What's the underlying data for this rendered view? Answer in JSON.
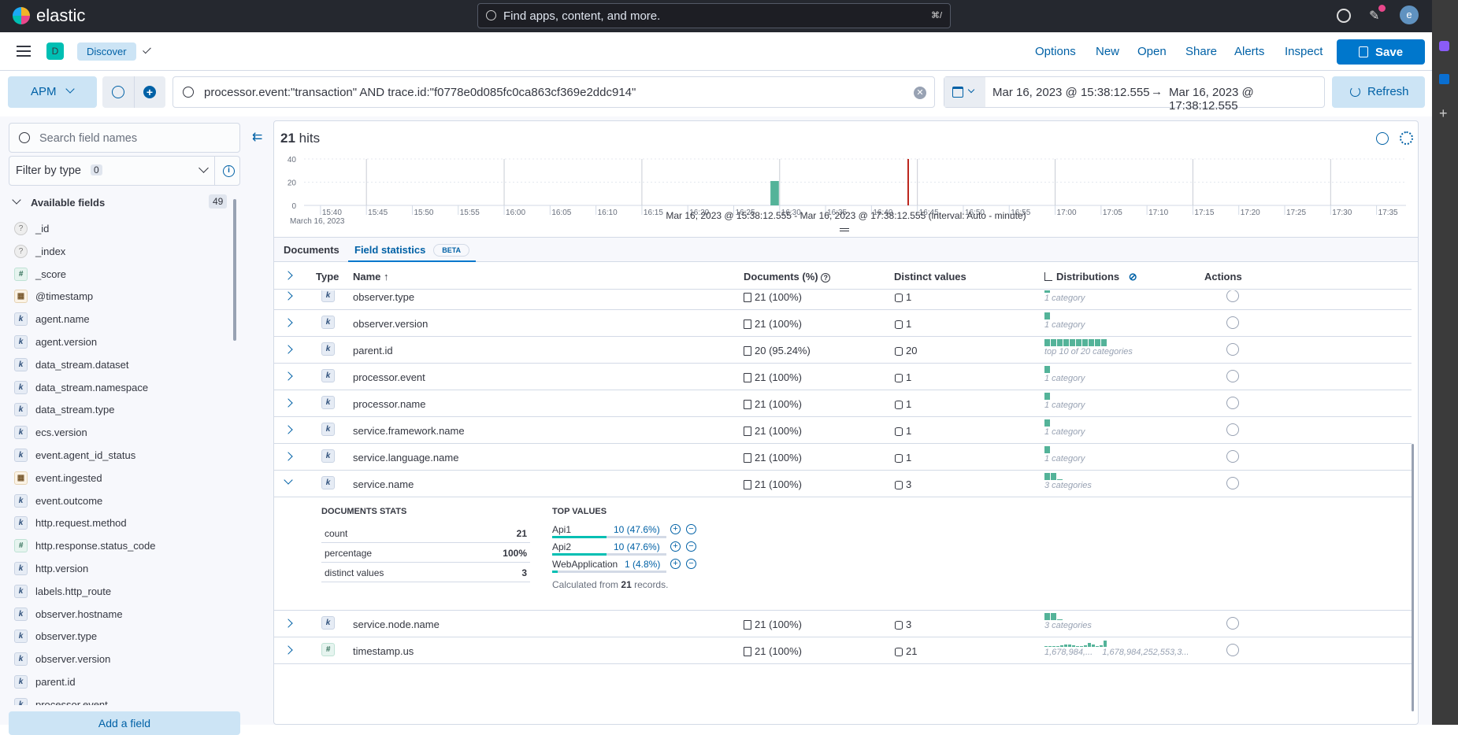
{
  "topbar": {
    "brand": "elastic",
    "search_placeholder": "Find apps, content, and more.",
    "shortcut": "⌘/",
    "avatar": "e"
  },
  "appbar": {
    "space": "D",
    "breadcrumb": "Discover",
    "links": [
      "Options",
      "New",
      "Open",
      "Share",
      "Alerts",
      "Inspect"
    ],
    "save": "Save"
  },
  "query": {
    "dataview": "APM",
    "value": "processor.event:\"transaction\" AND trace.id:\"f0778e0d085fc0ca863cf369e2ddc914\"",
    "date_start": "Mar 16, 2023 @ 15:38:12.555",
    "date_end": "Mar 16, 2023 @ 17:38:12.555",
    "arrow": "→",
    "refresh": "Refresh"
  },
  "sidebar": {
    "search_placeholder": "Search field names",
    "filter_label": "Filter by type",
    "filter_count": "0",
    "available_label": "Available fields",
    "available_count": "49",
    "fields": [
      {
        "name": "_id",
        "type": "unknown"
      },
      {
        "name": "_index",
        "type": "unknown"
      },
      {
        "name": "_score",
        "type": "number"
      },
      {
        "name": "@timestamp",
        "type": "date"
      },
      {
        "name": "agent.name",
        "type": "keyword"
      },
      {
        "name": "agent.version",
        "type": "keyword"
      },
      {
        "name": "data_stream.dataset",
        "type": "keyword"
      },
      {
        "name": "data_stream.namespace",
        "type": "keyword"
      },
      {
        "name": "data_stream.type",
        "type": "keyword"
      },
      {
        "name": "ecs.version",
        "type": "keyword"
      },
      {
        "name": "event.agent_id_status",
        "type": "keyword"
      },
      {
        "name": "event.ingested",
        "type": "date"
      },
      {
        "name": "event.outcome",
        "type": "keyword"
      },
      {
        "name": "http.request.method",
        "type": "keyword"
      },
      {
        "name": "http.response.status_code",
        "type": "number"
      },
      {
        "name": "http.version",
        "type": "keyword"
      },
      {
        "name": "labels.http_route",
        "type": "keyword"
      },
      {
        "name": "observer.hostname",
        "type": "keyword"
      },
      {
        "name": "observer.type",
        "type": "keyword"
      },
      {
        "name": "observer.version",
        "type": "keyword"
      },
      {
        "name": "parent.id",
        "type": "keyword"
      },
      {
        "name": "processor.event",
        "type": "keyword"
      }
    ],
    "add_field": "Add a field"
  },
  "hits": {
    "count": "21",
    "label": "hits"
  },
  "chart_data": {
    "type": "bar",
    "interval": "minute",
    "x_range": [
      "15:38:12.555",
      "17:38:12.555"
    ],
    "x_ticks": [
      "15:40",
      "15:45",
      "15:50",
      "15:55",
      "16:00",
      "16:05",
      "16:10",
      "16:15",
      "16:20",
      "16:25",
      "16:30",
      "16:35",
      "16:40",
      "16:45",
      "16:50",
      "16:55",
      "17:00",
      "17:05",
      "17:10",
      "17:15",
      "17:20",
      "17:25",
      "17:30",
      "17:35"
    ],
    "x_sublabel": "March 16, 2023",
    "y_ticks": [
      0,
      20,
      40
    ],
    "ylim": [
      0,
      40
    ],
    "bars": [
      {
        "x": "16:29",
        "value": 21
      }
    ],
    "current_time_marker": "16:44",
    "bar_color": "#54b399",
    "marker_color": "#bd271e",
    "caption": "Mar 16, 2023 @ 15:38:12.555 - Mar 16, 2023 @ 17:38:12.555 (interval: Auto - minute)"
  },
  "tabs": {
    "documents": "Documents",
    "field_stats": "Field statistics",
    "beta": "BETA"
  },
  "table": {
    "headers": {
      "type": "Type",
      "name": "Name ↑",
      "docs": "Documents (%)",
      "distinct": "Distinct values",
      "distributions": "Distributions",
      "actions": "Actions"
    },
    "rows": [
      {
        "name": "observer.type",
        "type": "keyword",
        "docs": "21 (100%)",
        "distinct": "1",
        "bars": [
          9
        ],
        "dist_label": "1 category"
      },
      {
        "name": "observer.version",
        "type": "keyword",
        "docs": "21 (100%)",
        "distinct": "1",
        "bars": [
          9
        ],
        "dist_label": "1 category"
      },
      {
        "name": "parent.id",
        "type": "keyword",
        "docs": "20 (95.24%)",
        "distinct": "20",
        "bars": [
          9,
          9,
          9,
          9,
          9,
          9,
          9,
          9,
          9,
          9
        ],
        "dist_label": "top 10 of 20 categories"
      },
      {
        "name": "processor.event",
        "type": "keyword",
        "docs": "21 (100%)",
        "distinct": "1",
        "bars": [
          9
        ],
        "dist_label": "1 category"
      },
      {
        "name": "processor.name",
        "type": "keyword",
        "docs": "21 (100%)",
        "distinct": "1",
        "bars": [
          9
        ],
        "dist_label": "1 category"
      },
      {
        "name": "service.framework.name",
        "type": "keyword",
        "docs": "21 (100%)",
        "distinct": "1",
        "bars": [
          9
        ],
        "dist_label": "1 category"
      },
      {
        "name": "service.language.name",
        "type": "keyword",
        "docs": "21 (100%)",
        "distinct": "1",
        "bars": [
          9
        ],
        "dist_label": "1 category"
      },
      {
        "name": "service.name",
        "type": "keyword",
        "docs": "21 (100%)",
        "distinct": "3",
        "bars": [
          9,
          9,
          1
        ],
        "dist_label": "3 categories",
        "expanded": true
      },
      {
        "name": "service.node.name",
        "type": "keyword",
        "docs": "21 (100%)",
        "distinct": "3",
        "bars": [
          9,
          9,
          1
        ],
        "dist_label": "3 categories"
      },
      {
        "name": "timestamp.us",
        "type": "number",
        "docs": "21 (100%)",
        "distinct": "21",
        "bars": [
          1,
          1,
          1,
          1,
          2,
          3,
          3,
          2,
          1,
          1,
          2,
          5,
          3,
          1,
          2,
          8
        ],
        "dist_label": "1,678,984,...    1,678,984,252,553,3..."
      }
    ],
    "expanded": {
      "doc_stats_title": "DOCUMENTS STATS",
      "stats": [
        {
          "label": "count",
          "value": "21"
        },
        {
          "label": "percentage",
          "value": "100%"
        },
        {
          "label": "distinct values",
          "value": "3"
        }
      ],
      "top_values_title": "TOP VALUES",
      "top_values": [
        {
          "label": "Api1",
          "value": "10 (47.6%)",
          "pct": 47.6
        },
        {
          "label": "Api2",
          "value": "10 (47.6%)",
          "pct": 47.6
        },
        {
          "label": "WebApplication",
          "value": "1 (4.8%)",
          "pct": 4.8
        }
      ],
      "calc_prefix": "Calculated from",
      "calc_count": "21",
      "calc_suffix": "records."
    }
  }
}
